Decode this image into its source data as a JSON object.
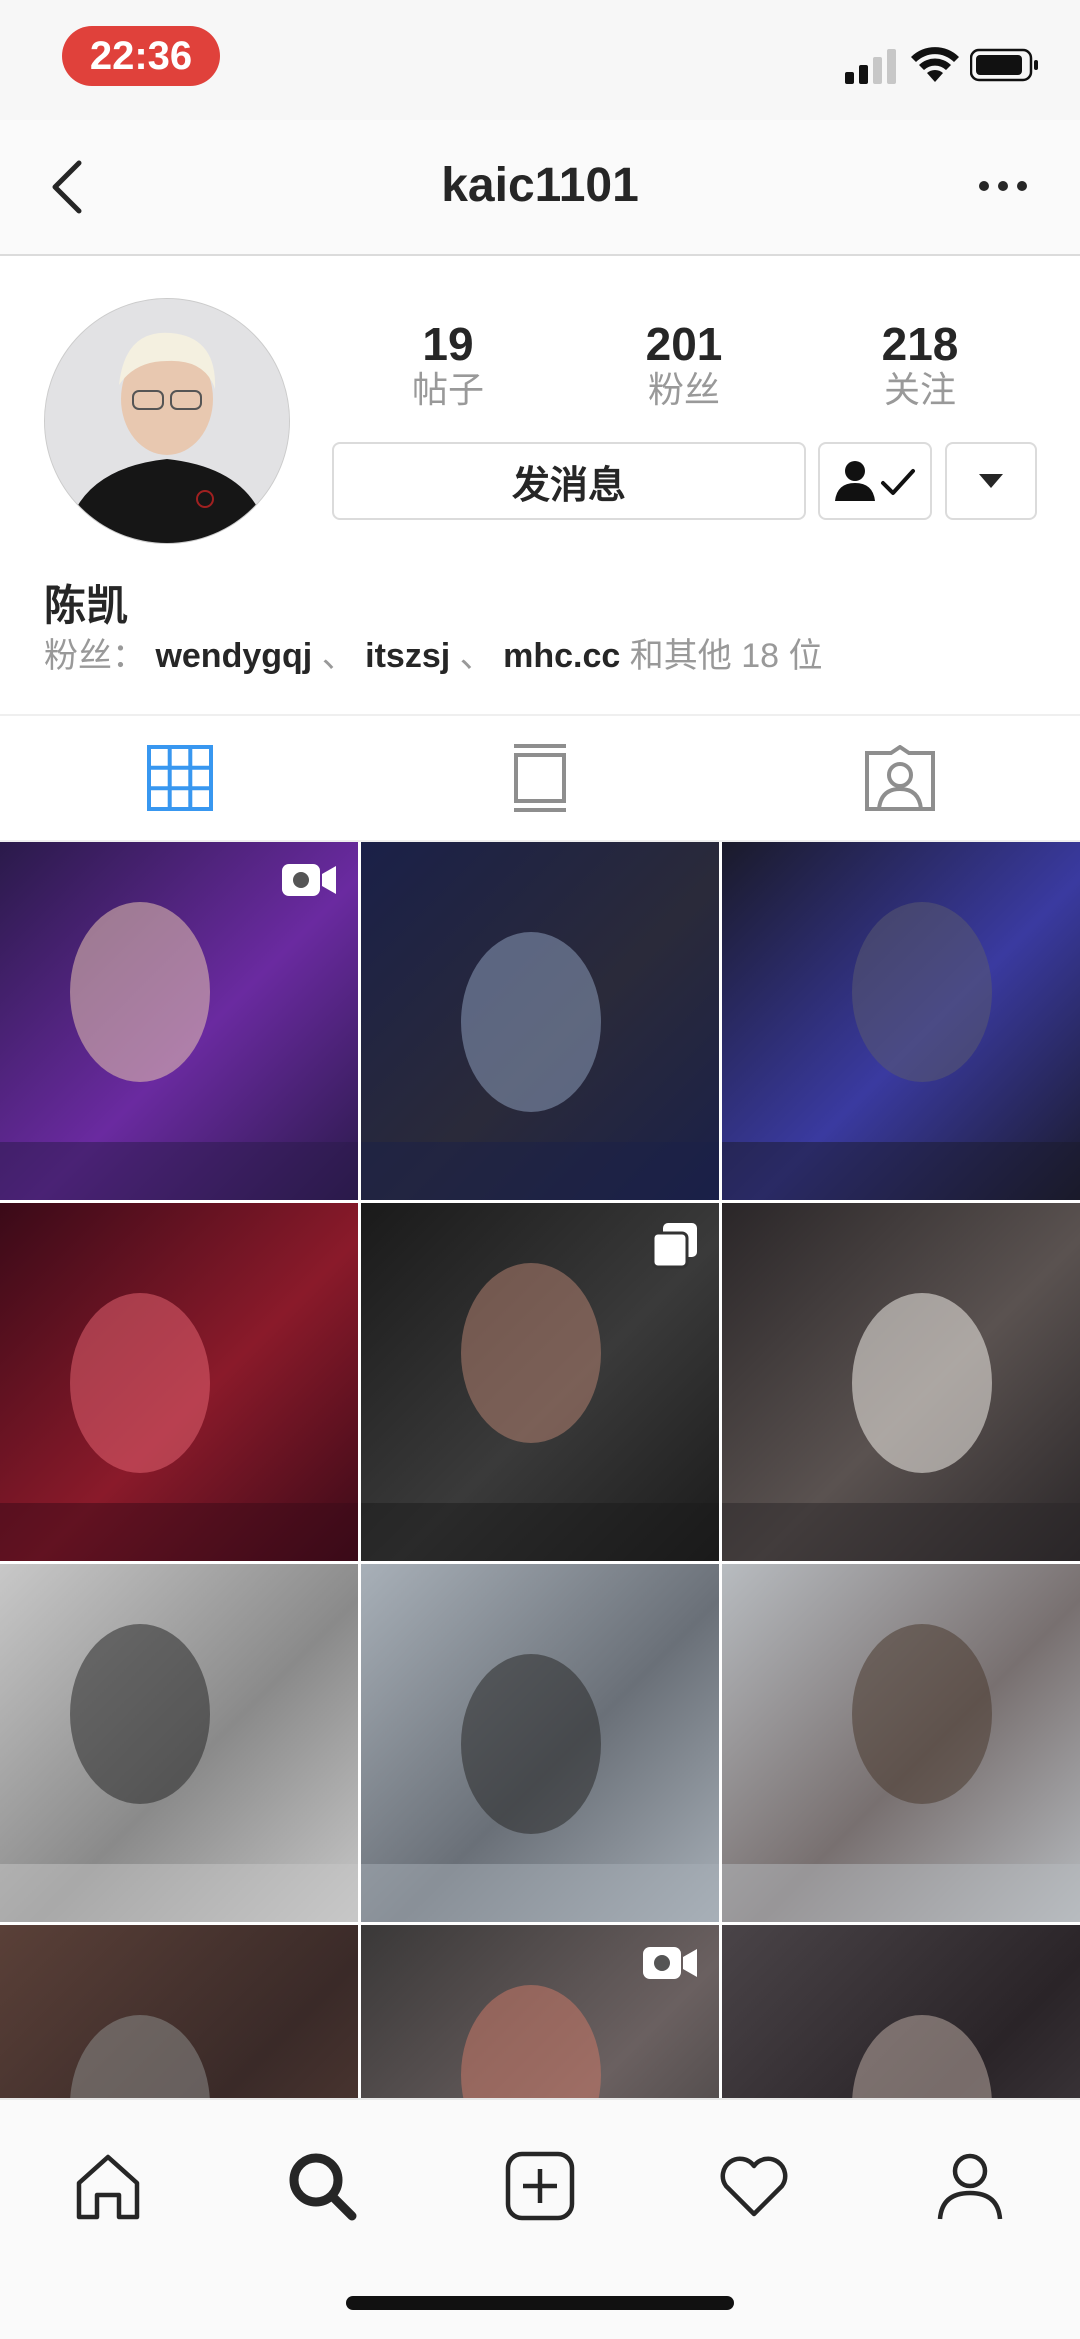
{
  "status_bar": {
    "time": "22:36",
    "time_pill_color": "#e0413b"
  },
  "header": {
    "title": "kaic1101"
  },
  "profile": {
    "stats": [
      {
        "value": "19",
        "label": "帖子"
      },
      {
        "value": "201",
        "label": "粉丝"
      },
      {
        "value": "218",
        "label": "关注"
      }
    ],
    "message_button": "发消息",
    "name": "陈凯",
    "followed_by": {
      "prefix": "粉丝：",
      "users": [
        "wendygqj",
        "itszsj",
        "mhc.cc"
      ],
      "separator": " 、 ",
      "suffix": "和其他 18 位"
    }
  },
  "tabs": [
    {
      "icon": "grid-icon",
      "active": true
    },
    {
      "icon": "feed-icon",
      "active": false
    },
    {
      "icon": "tagged-icon",
      "active": false
    }
  ],
  "accent_color": "#3897f0",
  "posts": [
    {
      "badge": "video-icon",
      "colors": [
        "#2a1a4a",
        "#e8c4b0",
        "#6a2aa0"
      ]
    },
    {
      "badge": null,
      "colors": [
        "#1a2048",
        "#8a9ab8",
        "#2a2a3a"
      ]
    },
    {
      "badge": null,
      "colors": [
        "#1a1a2a",
        "#5a5a70",
        "#3a3aa0"
      ]
    },
    {
      "badge": null,
      "colors": [
        "#3a0a18",
        "#e06070",
        "#8a1a2a"
      ]
    },
    {
      "badge": "carousel-icon",
      "colors": [
        "#1a1a1a",
        "#b08070",
        "#3a3a3a"
      ]
    },
    {
      "badge": null,
      "colors": [
        "#2a2628",
        "#f0ece8",
        "#5a5250"
      ]
    },
    {
      "badge": null,
      "colors": [
        "#c8c8c8",
        "#2a2a2a",
        "#8a8a8a"
      ]
    },
    {
      "badge": null,
      "colors": [
        "#a8b0b8",
        "#2a2a2a",
        "#6a7078"
      ]
    },
    {
      "badge": null,
      "colors": [
        "#b8bcc0",
        "#4a3a30",
        "#787070"
      ]
    },
    {
      "badge": null,
      "colors": [
        "#5a4038",
        "#8a8a88",
        "#3a2a28"
      ]
    },
    {
      "badge": "video-icon",
      "colors": [
        "#3a3838",
        "#c87868",
        "#6a6060"
      ]
    },
    {
      "badge": null,
      "colors": [
        "#4a4448",
        "#b8a8a0",
        "#2a2428"
      ]
    }
  ],
  "bottom_nav": [
    "home-icon",
    "search-icon",
    "new-post-icon",
    "activity-icon",
    "profile-icon"
  ]
}
